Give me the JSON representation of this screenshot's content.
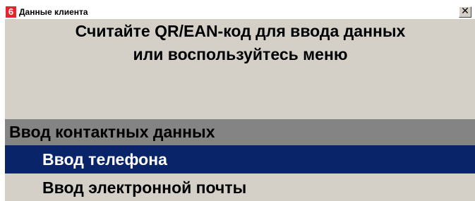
{
  "window": {
    "badge": "6",
    "title": "Данные клиента",
    "close_glyph": "✕"
  },
  "prompt": {
    "line1": "Считайте QR/EAN-код для ввода данных",
    "line2": "или воспользуйтесь меню"
  },
  "menu": {
    "header": "Ввод контактных данных",
    "items": [
      {
        "label": "Ввод телефона",
        "selected": true
      },
      {
        "label": "Ввод электронной почты",
        "selected": false
      }
    ]
  },
  "colors": {
    "window_bg": "#d4d0c8",
    "badge_bg": "#e1262c",
    "header_bg": "#848484",
    "selection_bg": "#0a246a"
  },
  "icons": {
    "badge": "app-badge-icon",
    "close": "close-icon"
  }
}
